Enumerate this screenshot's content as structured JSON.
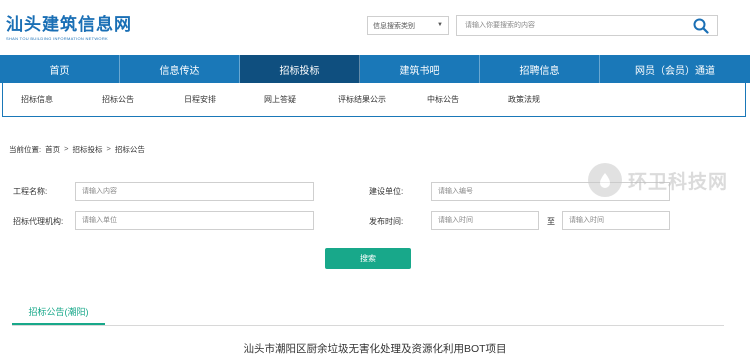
{
  "header": {
    "logo_title": "汕头建筑信息网",
    "logo_subtitle": "SHAN TOU BUILDING INFORMATION NETWORK",
    "search_category": "信息搜索类别",
    "search_placeholder": "请输入你要搜索的内容"
  },
  "nav": [
    {
      "label": "首页",
      "active": false
    },
    {
      "label": "信息传达",
      "active": false
    },
    {
      "label": "招标投标",
      "active": true
    },
    {
      "label": "建筑书吧",
      "active": false
    },
    {
      "label": "招聘信息",
      "active": false
    },
    {
      "label": "网员（会员）通道",
      "active": false
    }
  ],
  "subnav": [
    "招标信息",
    "招标公告",
    "日程安排",
    "网上答疑",
    "评标结果公示",
    "中标公告",
    "政策法规"
  ],
  "breadcrumb": {
    "prefix": "当前位置:",
    "items": [
      "首页",
      "招标投标",
      "招标公告"
    ],
    "sep": ">"
  },
  "form": {
    "project_name_label": "工程名称:",
    "project_name_placeholder": "请输入内容",
    "builder_label": "建设单位:",
    "builder_placeholder": "请输入编号",
    "agency_label": "招标代理机构:",
    "agency_placeholder": "请输入单位",
    "publish_time_label": "发布时间:",
    "time_from_placeholder": "请输入时间",
    "time_to_label": "至",
    "time_to_placeholder": "请输入时间",
    "search_button": "搜索"
  },
  "tab": {
    "label": "招标公告(潮阳)"
  },
  "list": {
    "first_title": "汕头市潮阳区厨余垃圾无害化处理及资源化利用BOT项目"
  },
  "watermark": {
    "text": "环卫科技网"
  },
  "colors": {
    "brand_blue": "#1a78b8",
    "nav_active": "#0f4f7f",
    "accent_green": "#18a88a"
  }
}
